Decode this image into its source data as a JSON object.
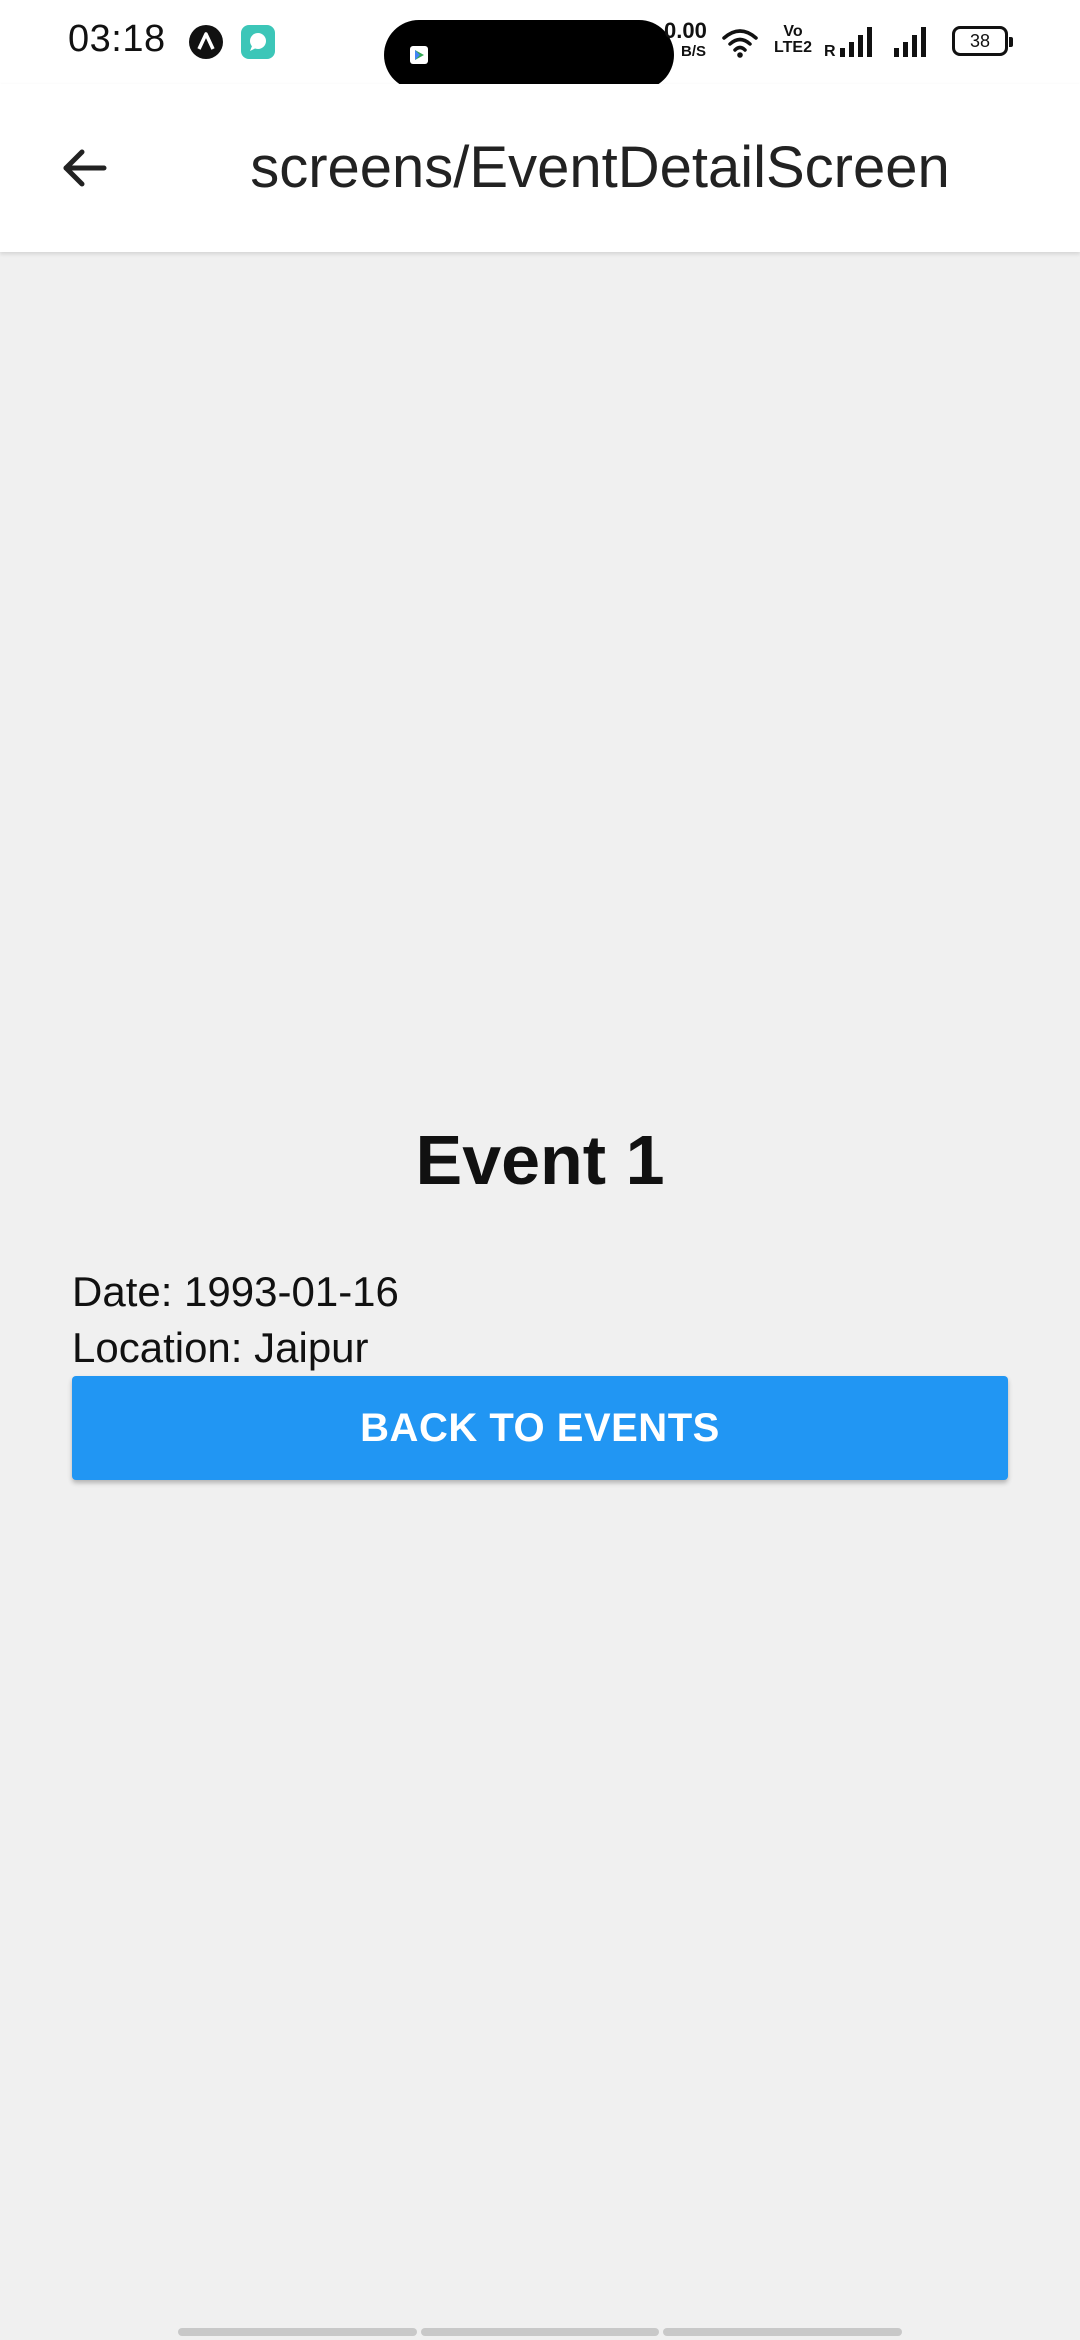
{
  "status_bar": {
    "time": "03:18",
    "notification_icons": [
      "a-letter-icon",
      "chat-bubble-icon"
    ],
    "network_speed_value": "0.00",
    "network_speed_unit": "B/S",
    "volte_label_top": "Vo",
    "volte_label_bottom": "LTE2",
    "signal_roaming_label": "R",
    "battery_level": "38"
  },
  "app_bar": {
    "title": "screens/EventDetailScreen",
    "back_icon": "arrow-left-icon"
  },
  "event": {
    "title": "Event 1",
    "date_text": "Date: 1993-01-16",
    "location_text": "Location: Jaipur"
  },
  "actions": {
    "back_button_label": "BACK TO EVENTS"
  },
  "colors": {
    "primary": "#2196f3",
    "background": "#f0f0f0",
    "app_bar": "#ffffff"
  }
}
